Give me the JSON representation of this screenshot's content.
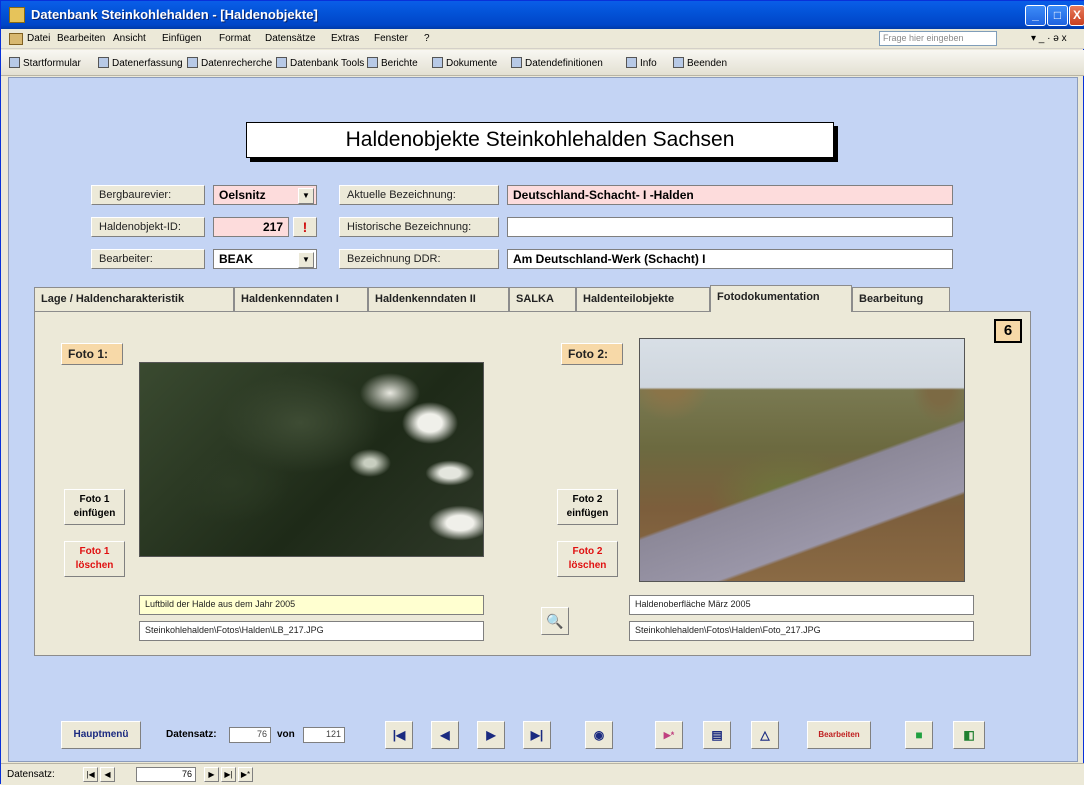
{
  "window": {
    "title": "Datenbank Steinkohlehalden - [Haldenobjekte]",
    "controls": [
      "_",
      "□",
      "X"
    ]
  },
  "menu": {
    "items": [
      "Datei",
      "Bearbeiten",
      "Ansicht",
      "Einfügen",
      "Format",
      "Datensätze",
      "Extras",
      "Fenster",
      "?"
    ],
    "help_placeholder": "Frage hier eingeben",
    "mdi_controls": "▾ _ · ə x"
  },
  "toolbar": {
    "items": [
      "Startformular",
      "Datenerfassung",
      "Datenrecherche",
      "Datenbank Tools",
      "Berichte",
      "Dokumente",
      "Datendefinitionen",
      "Info",
      "Beenden"
    ]
  },
  "form": {
    "title": "Haldenobjekte Steinkohlehalden Sachsen",
    "page_number": "6",
    "fields": {
      "bergbaurevier_label": "Bergbaurevier:",
      "bergbaurevier_value": "Oelsnitz",
      "haldenobjekt_id_label": "Haldenobjekt-ID:",
      "haldenobjekt_id_value": "217",
      "bearbeiter_label": "Bearbeiter:",
      "bearbeiter_value": "BEAK",
      "aktuelle_label": "Aktuelle Bezeichnung:",
      "aktuelle_value": "Deutschland-Schacht- I -Halden",
      "historische_label": "Historische Bezeichnung:",
      "historische_value": "",
      "ddr_label": "Bezeichnung DDR:",
      "ddr_value": "Am Deutschland-Werk (Schacht) I"
    },
    "tabs": [
      {
        "label": "Lage / Haldencharakteristik",
        "active": false
      },
      {
        "label": "Haldenkenndaten I",
        "active": false
      },
      {
        "label": "Haldenkenndaten II",
        "active": false
      },
      {
        "label": "SALKA",
        "active": false
      },
      {
        "label": "Haldenteilobjekte",
        "active": false
      },
      {
        "label": "Fotodokumentation",
        "active": true
      },
      {
        "label": "Bearbeitung",
        "active": false
      }
    ],
    "foto1": {
      "label": "Foto 1:",
      "insert_line1": "Foto 1",
      "insert_line2": "einfügen",
      "delete_line1": "Foto 1",
      "delete_line2": "löschen",
      "description": "Luftbild der Halde aus dem Jahr 2005",
      "path": "Steinkohlehalden\\Fotos\\Halden\\LB_217.JPG"
    },
    "foto2": {
      "label": "Foto 2:",
      "insert_line1": "Foto 2",
      "insert_line2": "einfügen",
      "delete_line1": "Foto 2",
      "delete_line2": "löschen",
      "description": "Haldenoberfläche März 2005",
      "path": "Steinkohlehalden\\Fotos\\Halden\\Foto_217.JPG"
    }
  },
  "navigation": {
    "hauptmenu": "Hauptmenü",
    "datensatz_label": "Datensatz:",
    "current_record": "76",
    "von_label": "von",
    "total_records": "121",
    "bearbeiten_label": "Bearbeiten"
  },
  "statusbar": {
    "label": "Datensatz:",
    "record": "76"
  }
}
